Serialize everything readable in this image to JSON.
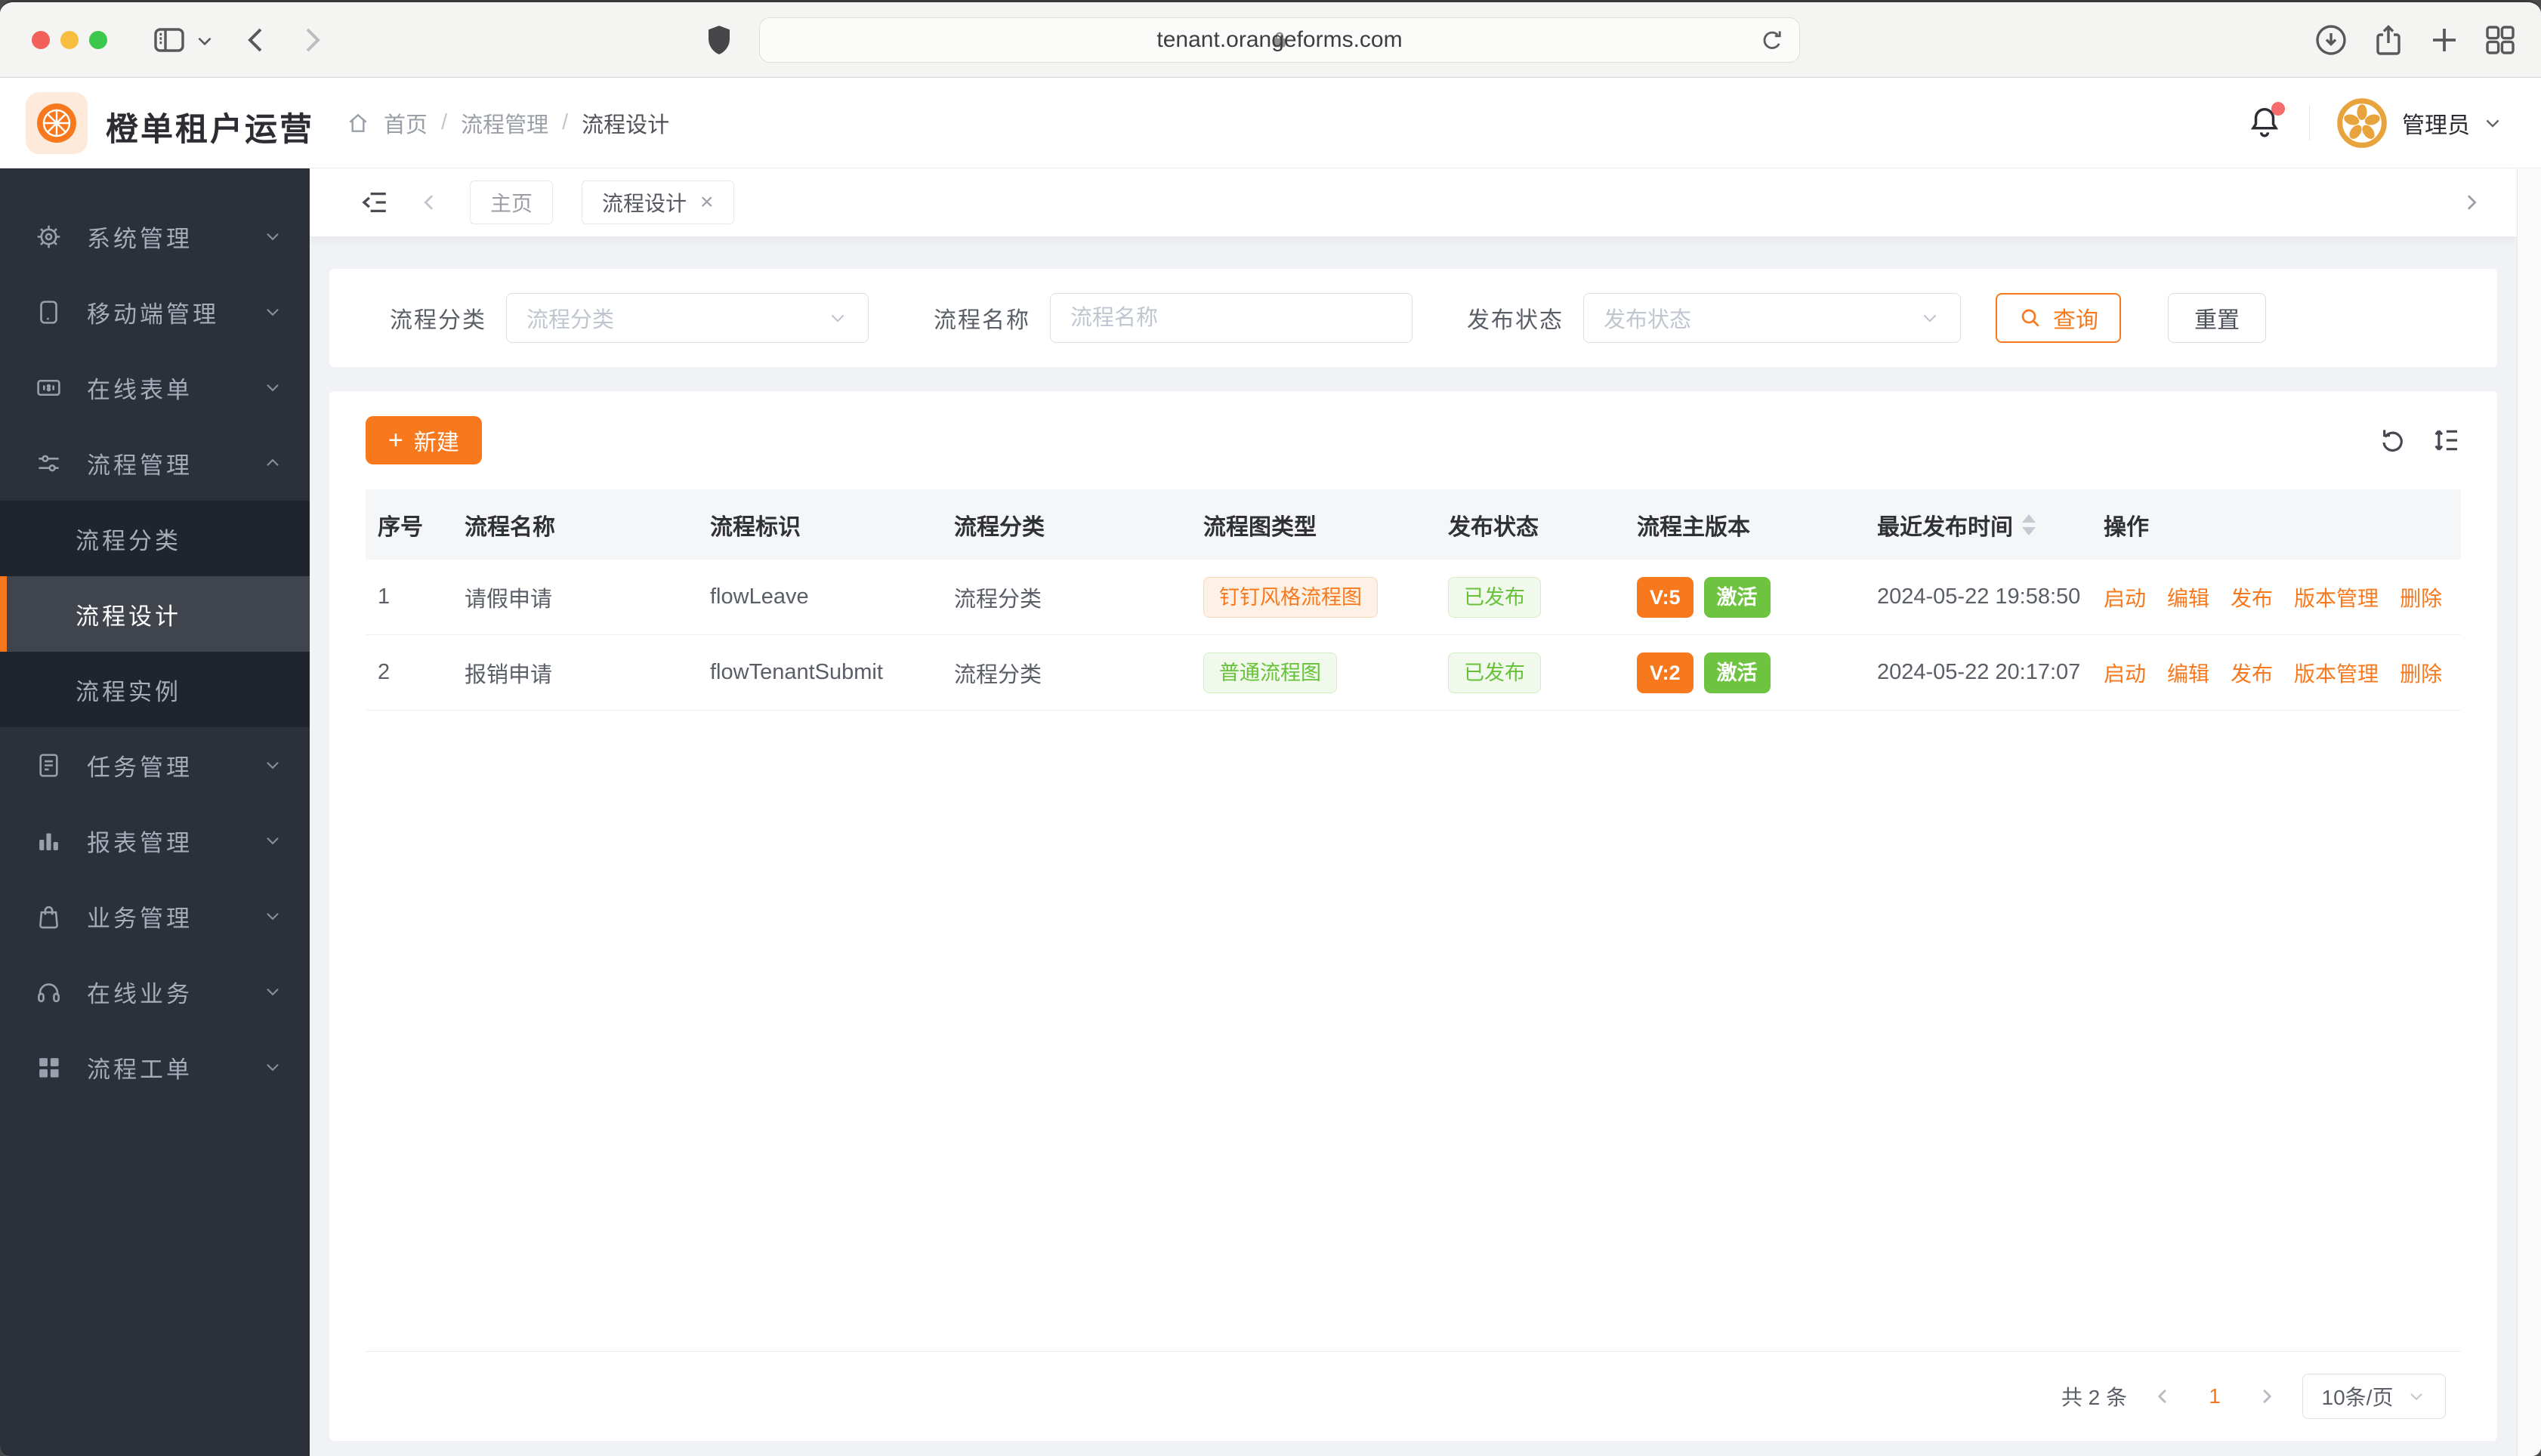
{
  "browser": {
    "url": "tenant.orangeforms.com"
  },
  "header": {
    "app_title": "橙单租户运营",
    "breadcrumb": {
      "home": "首页",
      "section": "流程管理",
      "current": "流程设计"
    },
    "user_name": "管理员"
  },
  "sidebar": {
    "items": [
      {
        "label": "系统管理",
        "icon": "gear-icon"
      },
      {
        "label": "移动端管理",
        "icon": "mobile-icon"
      },
      {
        "label": "在线表单",
        "icon": "form-icon"
      },
      {
        "label": "流程管理",
        "icon": "sliders-icon",
        "expanded": true,
        "children": [
          "流程分类",
          "流程设计",
          "流程实例"
        ],
        "active_child": "流程设计"
      },
      {
        "label": "任务管理",
        "icon": "tasks-icon"
      },
      {
        "label": "报表管理",
        "icon": "bar-chart-icon"
      },
      {
        "label": "业务管理",
        "icon": "bag-icon"
      },
      {
        "label": "在线业务",
        "icon": "headset-icon"
      },
      {
        "label": "流程工单",
        "icon": "grid-icon"
      }
    ]
  },
  "tabs": {
    "home_tab": "主页",
    "active_tab": "流程设计"
  },
  "filters": {
    "category_label": "流程分类",
    "category_placeholder": "流程分类",
    "name_label": "流程名称",
    "name_placeholder": "流程名称",
    "name_value": "",
    "status_label": "发布状态",
    "status_placeholder": "发布状态",
    "query_button": "查询",
    "reset_button": "重置"
  },
  "toolbar": {
    "create_button": "新建"
  },
  "table": {
    "headers": [
      "序号",
      "流程名称",
      "流程标识",
      "流程分类",
      "流程图类型",
      "发布状态",
      "流程主版本",
      "最近发布时间",
      "操作"
    ],
    "action_labels": [
      "启动",
      "编辑",
      "发布",
      "版本管理",
      "删除"
    ],
    "rows": [
      {
        "index": "1",
        "name": "请假申请",
        "key": "flowLeave",
        "category": "流程分类",
        "diagram_type": "钉钉风格流程图",
        "publish_status": "已发布",
        "version": "V:5",
        "version_state": "激活",
        "published_at": "2024-05-22 19:58:50"
      },
      {
        "index": "2",
        "name": "报销申请",
        "key": "flowTenantSubmit",
        "category": "流程分类",
        "diagram_type": "普通流程图",
        "publish_status": "已发布",
        "version": "V:2",
        "version_state": "激活",
        "published_at": "2024-05-22 20:17:07"
      }
    ]
  },
  "pagination": {
    "total": "共 2 条",
    "page": "1",
    "page_size": "10条/页"
  },
  "icons": {
    "plus": "+",
    "close": "×",
    "slash": "/"
  },
  "colors": {
    "accent": "#f8791d",
    "success": "#67c23a",
    "success_solid": "#6ec440",
    "sidebar_bg": "#2b303a",
    "page_bg": "#f0f2f5"
  }
}
